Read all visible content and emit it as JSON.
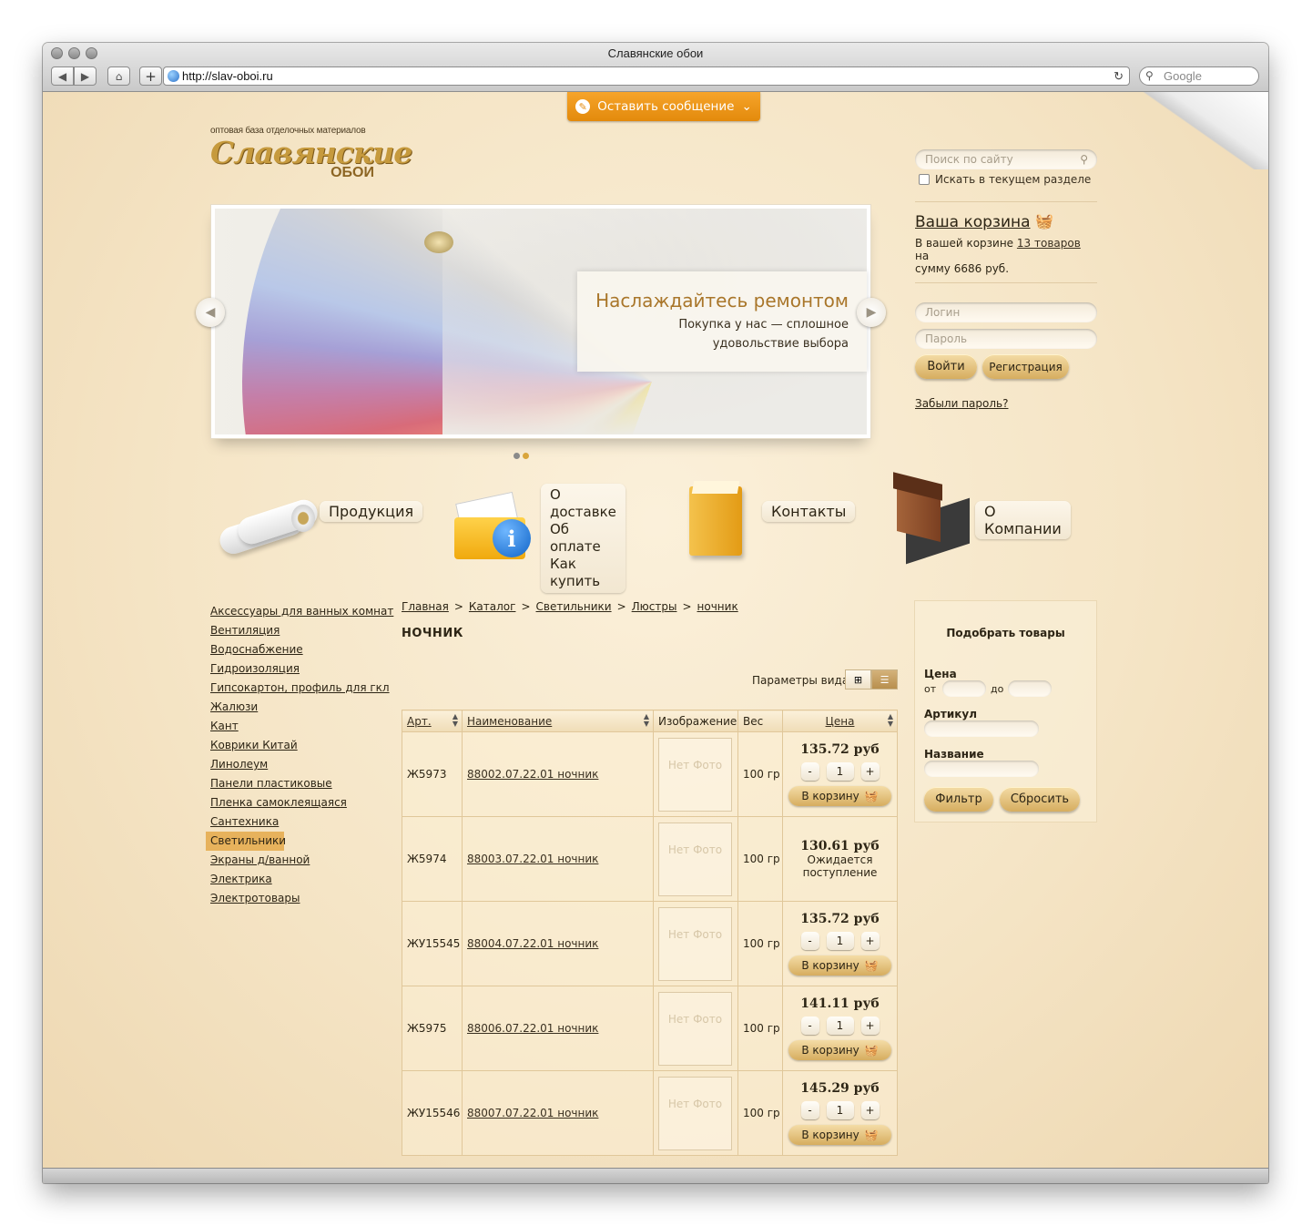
{
  "window": {
    "title": "Славянские обои",
    "url": "http://slav-oboi.ru",
    "search_placeholder": "Google"
  },
  "message_button": {
    "label": "Оставить сообщение"
  },
  "logo": {
    "tagline": "оптовая база отделочных материалов",
    "name_main": "Славянские",
    "name_sub": "ОБОИ"
  },
  "search": {
    "placeholder": "Поиск по сайту",
    "checkbox_label": "Искать в текущем разделе"
  },
  "cart": {
    "title": "Ваша корзина",
    "text_before": "В вашей корзине",
    "items_link": "13 товаров",
    "text_mid": "на",
    "text_after": "сумму 6686 руб."
  },
  "login": {
    "login_placeholder": "Логин",
    "password_placeholder": "Пароль",
    "login_button": "Войти",
    "register_button": "Регистрация",
    "forgot_link": "Забыли пароль?"
  },
  "slider": {
    "title": "Наслаждайтесь ремонтом",
    "text": "Покупка у нас — сплошное удовольствие выбора",
    "dot_active": "#8a8a8a",
    "dot_inactive": "#d9a53c"
  },
  "shortcuts": [
    {
      "label": "Продукция"
    },
    {
      "lines": [
        "О доставке",
        "Об оплате",
        "Как купить"
      ]
    },
    {
      "label": "Контакты"
    },
    {
      "label": "О Компании"
    }
  ],
  "categories": [
    "Аксессуары для ванных комнат",
    "Вентиляция",
    "Водоснабжение",
    "Гидроизоляция",
    "Гипсокартон, профиль для гкл",
    "Жалюзи",
    "Кант",
    "Коврики Китай",
    "Линолеум",
    "Панели пластиковые",
    "Пленка самоклеящаяся",
    "Сантехника",
    "Светильники",
    "Экраны д/ванной",
    "Электрика",
    "Электротовары"
  ],
  "breadcrumbs": [
    "Главная",
    "Каталог",
    "Светильники",
    "Люстры",
    "ночник"
  ],
  "breadcrumb_sep": ">",
  "page_title": "НОЧНИК",
  "view": {
    "label": "Параметры вида:"
  },
  "table": {
    "headers": {
      "art": "Арт.",
      "name": "Наименование",
      "image": "Изображение",
      "weight": "Вес",
      "price": "Цена"
    },
    "no_photo": "Нет Фото",
    "to_cart": "В корзину",
    "awaiting": "Ожидается поступление",
    "rows": [
      {
        "art": "Ж5973",
        "name": "88002.07.22.01 ночник",
        "weight": "100 гр",
        "price": "135.72 руб",
        "qty": "1",
        "available": true
      },
      {
        "art": "Ж5974",
        "name": "88003.07.22.01 ночник",
        "weight": "100 гр",
        "price": "130.61 руб",
        "qty": "",
        "available": false
      },
      {
        "art": "ЖУ15545",
        "name": "88004.07.22.01 ночник",
        "weight": "100 гр",
        "price": "135.72 руб",
        "qty": "1",
        "available": true
      },
      {
        "art": "Ж5975",
        "name": "88006.07.22.01 ночник",
        "weight": "100 гр",
        "price": "141.11 руб",
        "qty": "1",
        "available": true
      },
      {
        "art": "ЖУ15546",
        "name": "88007.07.22.01 ночник",
        "weight": "100 гр",
        "price": "145.29 руб",
        "qty": "1",
        "available": true
      }
    ]
  },
  "filter": {
    "title": "Подобрать товары",
    "price_label": "Цена",
    "from": "от",
    "to": "до",
    "article_label": "Артикул",
    "name_label": "Название",
    "filter_button": "Фильтр",
    "reset_button": "Сбросить"
  }
}
